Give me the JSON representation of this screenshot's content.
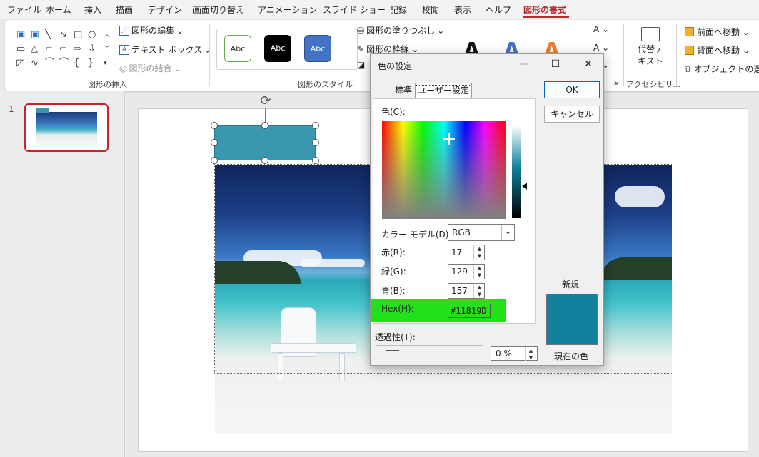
{
  "menu": {
    "tabs": [
      "ファイル",
      "ホーム",
      "挿入",
      "描画",
      "デザイン",
      "画面切り替え",
      "アニメーション",
      "スライド ショー",
      "記録",
      "校閲",
      "表示",
      "ヘルプ",
      "図形の書式"
    ],
    "active_tab": "図形の書式"
  },
  "ribbon": {
    "insert_shapes": {
      "edit_shape": "図形の編集",
      "text_box": "テキスト ボックス",
      "merge_shapes": "図形の結合",
      "label": "図形の挿入"
    },
    "shape_styles": {
      "sample_text": "Abc",
      "fill": "図形の塗りつぶし",
      "outline": "図形の枠線",
      "label": "図形のスタイル"
    },
    "accessibility": {
      "alt_text_line1": "代替テ",
      "alt_text_line2": "キスト",
      "label": "アクセシビリ..."
    },
    "arrange": {
      "bring_forward": "前面へ移動",
      "send_backward": "背面へ移動",
      "selection_pane": "オブジェクトの選択"
    }
  },
  "slides": {
    "number": "1"
  },
  "dialog": {
    "title": "色の設定",
    "tabs": [
      "標準",
      "ユーザー設定"
    ],
    "color_label": "色(C):",
    "color_model_label": "カラー モデル(D):",
    "color_model_value": "RGB",
    "red_label": "赤(R):",
    "green_label": "緑(G):",
    "blue_label": "青(B):",
    "red_value": "17",
    "green_value": "129",
    "blue_value": "157",
    "hex_label": "Hex(H):",
    "hex_value": "#11819D",
    "transparency_label": "透過性(T):",
    "transparency_value": "0 %",
    "ok": "OK",
    "cancel": "キャンセル",
    "new_label": "新規",
    "current_label": "現在の色",
    "current_color": "#11819D"
  },
  "colors": {
    "accent": "#c4262e",
    "shape_fill": "#3a97b0",
    "highlight": "#22e01a"
  }
}
